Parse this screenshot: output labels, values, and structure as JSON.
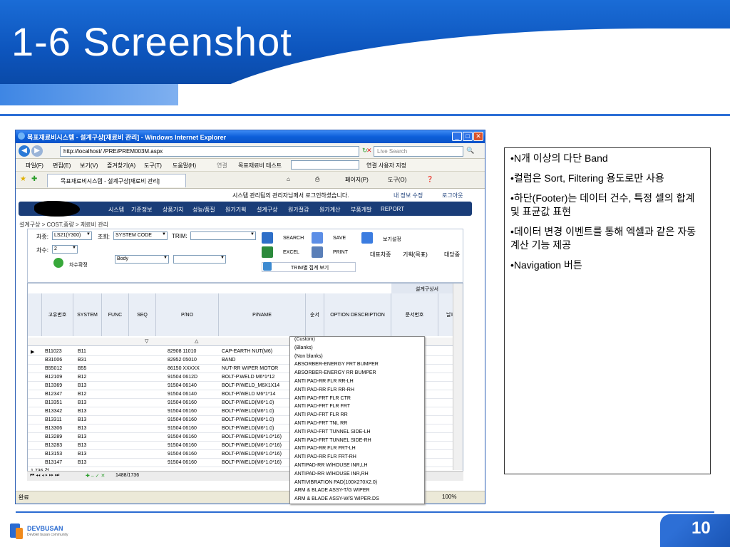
{
  "slide": {
    "title": "1-6 Screenshot",
    "page_number": "10",
    "footer_logo": "DEVBUSAN",
    "footer_logo_sub": "Devblet busan community"
  },
  "browser": {
    "window_title": "목표재료비시스템 - 설계구상[재료비 관리] - Windows Internet Explorer",
    "address": "http://localhost/      /PRE/PREM003M.aspx",
    "search_placeholder": "Live Search",
    "menu": [
      "파일(F)",
      "편집(E)",
      "보기(V)",
      "즐겨찾기(A)",
      "도구(T)",
      "도움말(H)"
    ],
    "link_label": "연결",
    "link_site": "목표재료비 테스트",
    "link_user": "연결 사용자 지정",
    "tab_label": "목표재료비시스템 - 설계구상[재료비 관리]",
    "tools": [
      "페이지(P)",
      "도구(O)"
    ],
    "status_left": "완료",
    "zoom": "100%"
  },
  "app": {
    "login_info": "시스템 관리팀의 관리자님께서 로그인하셨습니다.",
    "my_info": "내 정보 수정",
    "logout": "로그아웃",
    "nav": [
      "시스템",
      "기준정보",
      "상품가치",
      "성능/품질",
      "원가기획",
      "설계구상",
      "원가절감",
      "원가계산",
      "부품개발",
      "REPORT"
    ],
    "breadcrumb": "설계구상 > COST,중량 > 재료비 관리",
    "filters": {
      "car_label": "차종:",
      "car_value": "LS21(Y300)",
      "view_label": "조회:",
      "view_value": "SYSTEM CODE",
      "trim_label": "TRIM:",
      "degree_label": "차수:",
      "degree_value": "2",
      "body_value": "Body",
      "confirm_label": "차수확정"
    },
    "buttons": {
      "search": "SEARCH",
      "save": "SAVE",
      "settings": "보기설정",
      "excel": "EXCEL",
      "print": "PRINT",
      "trim_view": "TRIM별 집계 보기"
    },
    "right_headers": [
      "대표차종",
      "기획(목표)",
      "대당중"
    ]
  },
  "grid": {
    "group_header": "설계구상서",
    "columns": [
      "고유번호",
      "SYSTEM",
      "FUNC",
      "SEQ",
      "P/NO",
      "P/NAME",
      "순서",
      "OPTION DESCRIPTION",
      "문서번호",
      "날짜"
    ],
    "rows": [
      [
        "B11023",
        "B11",
        "",
        "",
        "82908 11010",
        "CAP-EARTH NUT(M6)"
      ],
      [
        "B31006",
        "B31",
        "",
        "",
        "82952 05010",
        "BAND"
      ],
      [
        "B55012",
        "B55",
        "",
        "",
        "86150 XXXXX",
        "NUT-RR WIPER MOTOR"
      ],
      [
        "B12109",
        "B12",
        "",
        "",
        "91504 0612D",
        "BOLT-P.WELD M6*1*12"
      ],
      [
        "B13369",
        "B13",
        "",
        "",
        "91504 06140",
        "BOLT-P/WELD_M6X1X14"
      ],
      [
        "B12347",
        "B12",
        "",
        "",
        "91504 06140",
        "BOLT-P/WELD M6*1*14"
      ],
      [
        "B13351",
        "B13",
        "",
        "",
        "91504 06160",
        "BOLT-P/WELD(M6*1.0)"
      ],
      [
        "B13342",
        "B13",
        "",
        "",
        "91504 06160",
        "BOLT-P/WELD(M6*1.0)"
      ],
      [
        "B13311",
        "B13",
        "",
        "",
        "91504 06160",
        "BOLT-P/WELD(M6*1.0)"
      ],
      [
        "B13306",
        "B13",
        "",
        "",
        "91504 06160",
        "BOLT-P/WELD(M6*1.0)"
      ],
      [
        "B13289",
        "B13",
        "",
        "",
        "91504 06160",
        "BOLT-P/WELD(M6*1.0*16)"
      ],
      [
        "B13283",
        "B13",
        "",
        "",
        "91504 06160",
        "BOLT-P/WELD(M6*1.0*16)"
      ],
      [
        "B13153",
        "B13",
        "",
        "",
        "91504 06160",
        "BOLT-P/WELD(M6*1.0*16)"
      ],
      [
        "B13147",
        "B13",
        "",
        "",
        "91504 06160",
        "BOLT-P/WELD(M6*1.0*16)"
      ]
    ],
    "count": "1,736 건",
    "pager_pos": "1488/1736"
  },
  "dropdown": [
    "(Custom)",
    "(Blanks)",
    "(Non blanks)",
    "ABSORBER-ENERGY FRT BUMPER",
    "ABSORBER-ENERGY RR BUMPER",
    "ANTI PAD-RR FLR RR-LH",
    "ANTI PAD-RR FLR RR-RH",
    "ANTI PAD-FRT FLR CTR",
    "ANTI PAD-FRT FLR FRT",
    "ANTI PAD-FRT FLR RR",
    "ANTI PAD-FRT TNL RR",
    "ANTI PAD-FRT TUNNEL SIDE-LH",
    "ANTI PAD-FRT TUNNEL SIDE-RH",
    "ANTI PAD-RR FLR FRT-LH",
    "ANTI PAD-RR FLR FRT-RH",
    "ANTIPAD-RR W/HOUSE INR,LH",
    "ANTIPAD-RR W/HOUSE INR,RH",
    "ANTIVIBRATION PAD(100X270X2.0)",
    "ARM & BLADE ASSY-T/G WIPER",
    "ARM & BLADE ASSY-W/S WIPER.DS"
  ],
  "notes": [
    "•N개 이상의 다단 Band",
    "•컬럼은 Sort, Filtering 용도로만 사용",
    "•하단(Footer)는 데이터 건수, 특정 셀의 합계 및 표균값 표현",
    "•데이터 변경 이벤트를 통해 엑셀과 같은 자동 계산 기능 제공",
    "•Navigation 버튼"
  ],
  "colors": {
    "header_blue": "#0d55bd",
    "nav_dark": "#1a3d78",
    "titlebar": "#0d5fd9"
  }
}
